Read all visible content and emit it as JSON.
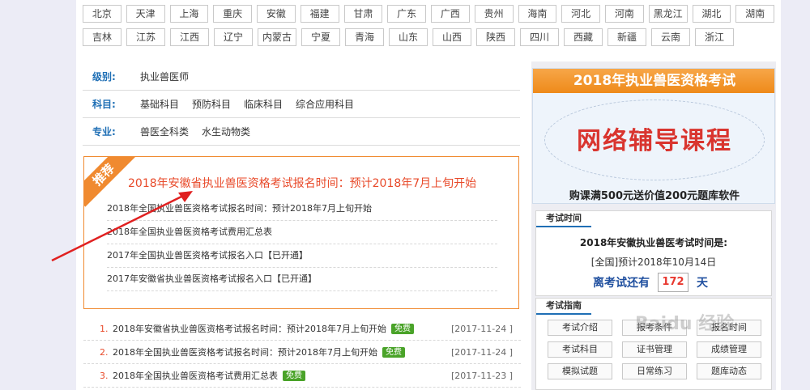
{
  "provinces": {
    "row1": [
      "北京",
      "天津",
      "上海",
      "重庆",
      "安徽",
      "福建",
      "甘肃",
      "广东",
      "广西",
      "贵州",
      "海南",
      "河北",
      "河南",
      "黑龙江",
      "湖北",
      "湖南"
    ],
    "row2": [
      "吉林",
      "江苏",
      "江西",
      "辽宁",
      "内蒙古",
      "宁夏",
      "青海",
      "山东",
      "山西",
      "陕西",
      "四川",
      "西藏",
      "新疆",
      "云南",
      "浙江"
    ]
  },
  "filters": {
    "level": {
      "label": "级别:",
      "items": [
        "执业兽医师"
      ]
    },
    "subject": {
      "label": "科目:",
      "items": [
        "基础科目",
        "预防科目",
        "临床科目",
        "综合应用科目"
      ]
    },
    "major": {
      "label": "专业:",
      "items": [
        "兽医全科类",
        "水生动物类"
      ]
    }
  },
  "recommend": {
    "badge": "推荐",
    "headline": "2018年安徽省执业兽医资格考试报名时间：预计2018年7月上旬开始",
    "items": [
      "2018年全国执业兽医资格考试报名时间：预计2018年7月上旬开始",
      "2018年全国执业兽医资格考试费用汇总表",
      "2017年全国执业兽医资格考试报名入口【已开通】",
      "2017年安徽省执业兽医资格考试报名入口【已开通】"
    ]
  },
  "news": [
    {
      "num": "1.",
      "title": "2018年安徽省执业兽医资格考试报名时间：预计2018年7月上旬开始",
      "badge": "免费",
      "date": "[2017-11-24 ]"
    },
    {
      "num": "2.",
      "title": "2018年全国执业兽医资格考试报名时间：预计2018年7月上旬开始",
      "badge": "免费",
      "date": "[2017-11-24 ]"
    },
    {
      "num": "3.",
      "title": "2018年全国执业兽医资格考试费用汇总表",
      "badge": "免费",
      "date": "[2017-11-23 ]"
    }
  ],
  "banner": {
    "top": "2018年执业兽医资格考试",
    "middle": "网络辅导课程",
    "bottom": "购课满500元送价值200元题库软件"
  },
  "exam": {
    "tab": "考试时间",
    "title": "2018年安徽执业兽医考试时间是:",
    "date": "[全国]预计2018年10月14日",
    "countdown_prefix": "离考试还有",
    "days": "172",
    "countdown_suffix": "天"
  },
  "guide": {
    "tab": "考试指南",
    "buttons": [
      "考试介绍",
      "报考条件",
      "报名时间",
      "考试科目",
      "证书管理",
      "成绩管理",
      "模拟试题",
      "日常练习",
      "题库动态"
    ]
  },
  "watermark": "Baidu 经验",
  "colors": {
    "accent_blue": "#1f6fb5",
    "orange": "#f08a30",
    "red": "#e84a2a",
    "green": "#4aa329"
  }
}
